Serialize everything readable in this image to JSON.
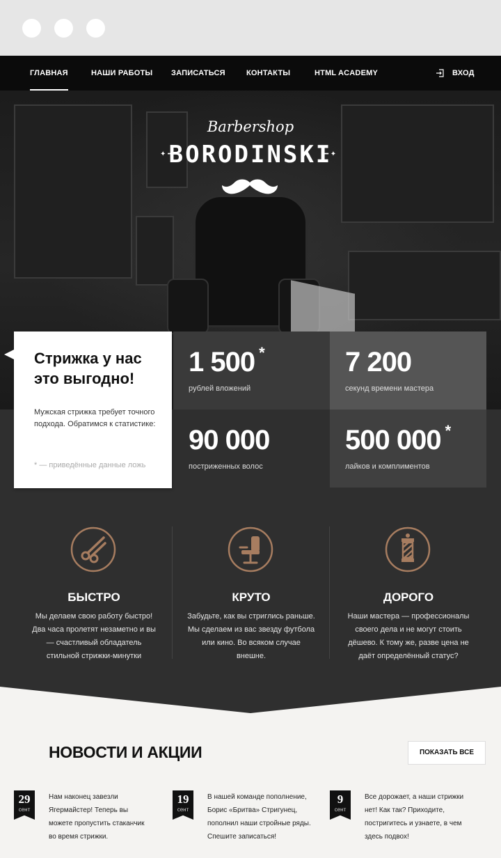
{
  "nav": {
    "items": [
      "Главная",
      "Наши работы",
      "Записаться",
      "Контакты",
      "HTML Academy"
    ],
    "login": "Вход"
  },
  "hero": {
    "logo_script": "Barbershop",
    "logo_main": "BORODINSKI"
  },
  "intro": {
    "title": "Стрижка у нас это выгодно!",
    "text": "Мужская стрижка требует точного подхода. Обратимся к статистике:",
    "note": "* — приведённые данные ложь"
  },
  "stats": [
    {
      "number": "1 500",
      "star": "*",
      "label": "рублей вложений"
    },
    {
      "number": "7 200",
      "star": "",
      "label": "секунд времени мастера"
    },
    {
      "number": "90 000",
      "star": "",
      "label": "постриженных волос"
    },
    {
      "number": "500 000",
      "star": "*",
      "label": "лайков и комплиментов"
    }
  ],
  "features": [
    {
      "title": "БЫСТРО",
      "text": "Мы делаем свою работу быстро! Два часа пролетят незаметно и вы — счастливый обладатель стильной стрижки-минутки",
      "icon": "scissors-icon"
    },
    {
      "title": "КРУТО",
      "text": "Забудьте, как вы стриглись раньше. Мы сделаем из вас звезду футбола или кино. Во всяком случае внешне.",
      "icon": "barber-chair-icon"
    },
    {
      "title": "ДОРОГО",
      "text": "Наши мастера — профессионалы своего дела и не могут стоить дёшево. К тому же, разве цена не даёт определённый статус?",
      "icon": "barber-pole-icon"
    }
  ],
  "news": {
    "title": "НОВОСТИ И АКЦИИ",
    "show_all": "ПОКАЗАТЬ ВСЕ",
    "items": [
      {
        "day": "29",
        "month": "сент",
        "text": "Нам наконец завезли Ягермайстер! Теперь вы можете пропустить стаканчик во время стрижки."
      },
      {
        "day": "19",
        "month": "сент",
        "text": "В нашей команде пополнение, Борис «Бритва» Стригунец, пополнил наши стройные ряды. Спешите записаться!"
      },
      {
        "day": "9",
        "month": "сент",
        "text": "Все дорожает, а наши стрижки нет! Как так? Приходите, постригитесь и узнаете, в чем здесь подвох!"
      }
    ]
  },
  "colors": {
    "accent": "#a77d60",
    "dark": "#2f2f2f",
    "nav": "#0b0b0b",
    "light_bg": "#f4f3f1"
  }
}
